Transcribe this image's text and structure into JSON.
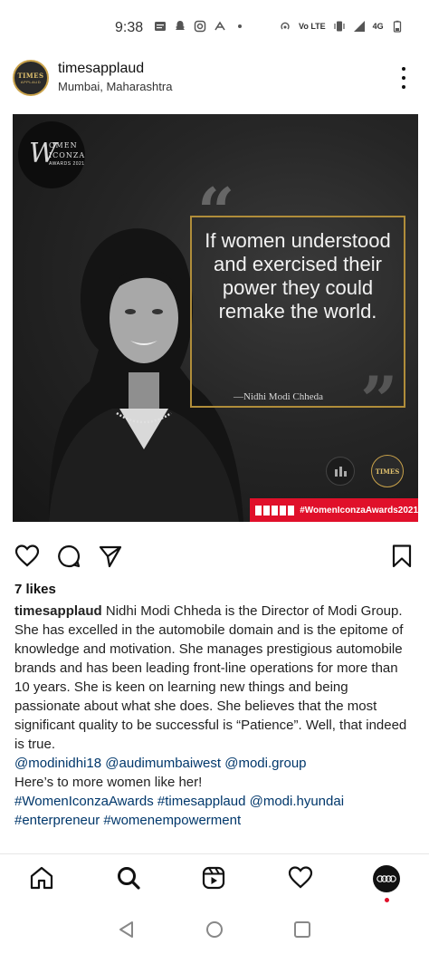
{
  "status_bar": {
    "time": "9:38",
    "network_label": "4G",
    "volte_label": "Vo LTE"
  },
  "post": {
    "username": "timesapplaud",
    "location": "Mumbai, Maharashtra",
    "avatar_text": "TIMES",
    "avatar_subtext": "APPLAUD"
  },
  "image": {
    "award_line1": "OMEN",
    "award_line2": "ICONZA",
    "award_line3": "AWARDS 2021",
    "quote": "If women understood and exercised their power they could remake the world.",
    "quote_author": "—Nidhi Modi Chheda",
    "small_logo_text": "TIMES",
    "hashtag": "#WomenIconzaAwards2021"
  },
  "likes": "7 likes",
  "caption": {
    "username": "timesapplaud",
    "first_line": "Nidhi Modi Chheda is the Director of Modi Group.",
    "body": "She has excelled in the automobile domain and is the epitome of knowledge and motivation. She manages prestigious automobile brands and has been leading front-line operations for more than 10 years. She is keen on learning new things and being passionate about what she does. She believes that the most significant quality to be successful is “Patience”. Well, that indeed is true.",
    "mentions": "@modinidhi18 @audimumbaiwest @modi.group",
    "closing": "Here’s to more women like her!",
    "hashtags_line1": "#WomenIconzaAwards #timesapplaud @modi.hyundai",
    "hashtags_line2": "#enterpreneur #womenempowerment"
  },
  "colors": {
    "accent_gold": "#b08d3a",
    "hashtag_red": "#e0102a",
    "link_blue": "#00376b"
  },
  "icons": {
    "actions": [
      "heart-icon",
      "comment-icon",
      "share-icon",
      "bookmark-icon"
    ],
    "nav": [
      "home-icon",
      "search-icon",
      "reels-icon",
      "heart-icon",
      "profile-avatar"
    ],
    "system": [
      "back-icon",
      "home-circle-icon",
      "recents-icon"
    ]
  }
}
